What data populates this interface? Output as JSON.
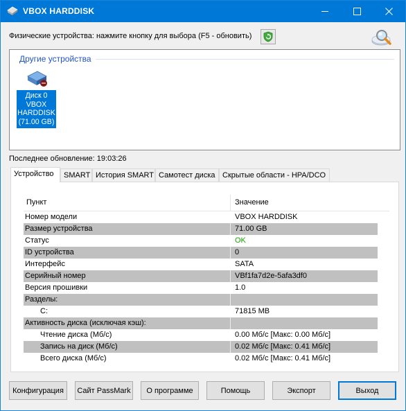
{
  "window": {
    "title": "VBOX HARDDISK"
  },
  "header": {
    "physical_devices_label": "Физические устройства: нажмите кнопку для выбора (F5 - обновить)"
  },
  "devices": {
    "group_title": "Другие устройства",
    "items": [
      {
        "line1": "Диск 0",
        "line2": "VBOX",
        "line3": "HARDDISK",
        "line4": "(71.00 GB)"
      }
    ]
  },
  "last_update": "Последнее обновление: 19:03:26",
  "tabs": [
    {
      "label": "Устройство",
      "active": true
    },
    {
      "label": "SMART"
    },
    {
      "label": "История SMART"
    },
    {
      "label": "Самотест диска"
    },
    {
      "label": "Скрытые области - HPA/DCO"
    }
  ],
  "table": {
    "columns": [
      "Пункт",
      "Значение"
    ],
    "rows": [
      {
        "item": "Номер модели",
        "value": "VBOX HARDDISK"
      },
      {
        "item": "Размер устройства",
        "value": "71.00 GB"
      },
      {
        "item": "Статус",
        "value": "OK"
      },
      {
        "item": "ID устройства",
        "value": "0"
      },
      {
        "item": "Интерфейс",
        "value": "SATA"
      },
      {
        "item": "Серийный номер",
        "value": "VBf1fa7d2e-5afa3df0"
      },
      {
        "item": "Версия прошивки",
        "value": "1.0"
      },
      {
        "item": "Разделы:",
        "value": ""
      },
      {
        "item": "C:",
        "value": "71815 MB"
      },
      {
        "item": "Активность диска (исключая кэш):",
        "value": ""
      },
      {
        "item": "Чтение диска (Мб/с)",
        "value": "0.00 Мб/с [Макс: 0.00 Мб/с]"
      },
      {
        "item": "Запись на диск (Мб/с)",
        "value": "0.02 Мб/с [Макс: 0.41 Мб/с]"
      },
      {
        "item": "Всего диска (Мб/с)",
        "value": "0.02 Мб/с [Макс: 0.41 Мб/с]"
      }
    ]
  },
  "buttons": {
    "config": "Конфигурация",
    "passmark": "Сайт PassMark",
    "about": "О программе",
    "help": "Помощь",
    "export": "Экспорт",
    "exit": "Выход"
  },
  "colors": {
    "titlebar": "#0078d7",
    "selection": "#0078d7",
    "status_ok": "#17a300",
    "row_shade": "#c0c0c0"
  },
  "icons": [
    "app-disk-icon",
    "minimize-icon",
    "maximize-icon",
    "close-icon",
    "refresh-shield-icon",
    "magnifier-icon",
    "harddisk-icon"
  ]
}
